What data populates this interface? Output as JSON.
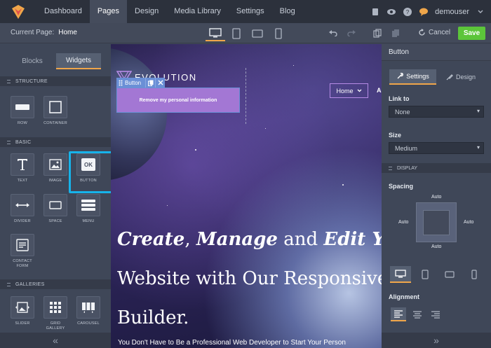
{
  "nav": {
    "items": [
      {
        "label": "Dashboard"
      },
      {
        "label": "Pages"
      },
      {
        "label": "Design"
      },
      {
        "label": "Media Library"
      },
      {
        "label": "Settings"
      },
      {
        "label": "Blog"
      }
    ],
    "active": "Pages",
    "user": "demouser",
    "accent": "#f0a64a"
  },
  "toolbar": {
    "current_page_label": "Current Page:",
    "current_page": "Home",
    "cancel_label": "Cancel",
    "save_label": "Save"
  },
  "left": {
    "tabs": {
      "blocks": "Blocks",
      "widgets": "Widgets"
    },
    "sections": {
      "structure": "STRUCTURE",
      "basic": "BASIC",
      "galleries": "GALLERIES"
    },
    "structure": [
      {
        "label": "ROW"
      },
      {
        "label": "CONTAINER"
      }
    ],
    "basic": [
      {
        "label": "TEXT"
      },
      {
        "label": "IMAGE"
      },
      {
        "label": "BUTTON"
      },
      {
        "label": "DIVIDER"
      },
      {
        "label": "SPACE"
      },
      {
        "label": "MENU"
      },
      {
        "label": "CONTACT FORM"
      }
    ],
    "galleries": [
      {
        "label": "SLIDER"
      },
      {
        "label": "GRID GALLERY"
      },
      {
        "label": "CAROUSEL"
      }
    ],
    "button_icon_text": "OK",
    "collapse": "«"
  },
  "canvas": {
    "brand": "EVOLUTION",
    "menu_home": "Home",
    "menu_next": "Ab",
    "selected_widget": "Button",
    "button_text": "Remove my personal information",
    "headline_part1": "Create",
    "headline_sep1": ",",
    "headline_part2": "Manage",
    "headline_and": "and",
    "headline_part3": "Edit You",
    "headline_line2": "Website with Our Responsive",
    "headline_line3": "Builder.",
    "subtext": "You Don't Have to Be a Professional Web Developer to Start Your Person"
  },
  "right": {
    "title": "Button",
    "tabs": {
      "settings": "Settings",
      "design": "Design"
    },
    "link_to_label": "Link to",
    "link_to_value": "None",
    "size_label": "Size",
    "size_value": "Medium",
    "display_section": "DISPLAY",
    "spacing_label": "Spacing",
    "spacing": {
      "top": "Auto",
      "left": "Auto",
      "right": "Auto",
      "bottom": "Auto"
    },
    "alignment_label": "Alignment",
    "expand": "»"
  }
}
